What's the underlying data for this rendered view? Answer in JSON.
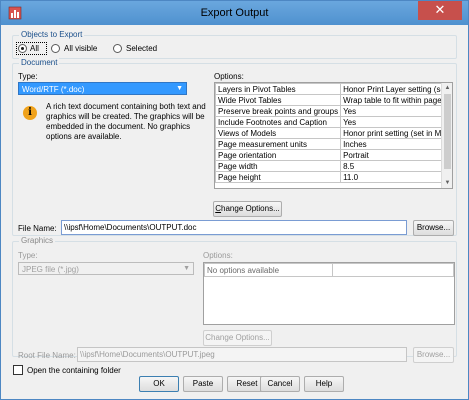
{
  "window": {
    "title": "Export Output",
    "close_glyph": "✕"
  },
  "objects": {
    "legend": "Objects to Export",
    "options": [
      {
        "label": "All",
        "selected": true
      },
      {
        "label": "All visible",
        "selected": false
      },
      {
        "label": "Selected",
        "selected": false
      }
    ]
  },
  "document": {
    "legend": "Document",
    "type_label": "Type:",
    "type_value": "Word/RTF (*.doc)",
    "info_icon": "info-icon",
    "description": "A rich text document containing both text and graphics will be created. The graphics will be embedded in the document. No graphics options are available.",
    "options_label": "Options:",
    "options": [
      [
        "Layers in Pivot Tables",
        "Honor Print Layer setting (set in ..."
      ],
      [
        "Wide Pivot Tables",
        "Wrap table to fit within page mar..."
      ],
      [
        "Preserve break points and groups",
        "Yes"
      ],
      [
        "Include Footnotes and Caption",
        "Yes"
      ],
      [
        "Views of Models",
        "Honor print setting (set in Model ..."
      ],
      [
        "Page measurement units",
        "Inches"
      ],
      [
        "Page orientation",
        "Portrait"
      ],
      [
        "Page width",
        "8.5"
      ],
      [
        "Page height",
        "11.0"
      ]
    ],
    "change_options": "Change Options...",
    "file_name_label": "File Name:",
    "file_name_value": "\\\\ipsf\\Home\\Documents\\OUTPUT.doc",
    "browse": "Browse..."
  },
  "graphics": {
    "legend": "Graphics",
    "type_label": "Type:",
    "type_value": "JPEG file (*.jpg)",
    "options_label": "Options:",
    "options_placeholder": "No options available",
    "change_options": "Change Options...",
    "root_file_label": "Root File Name:",
    "root_file_value": "\\\\ipsf\\Home\\Documents\\OUTPUT.jpeg",
    "browse": "Browse..."
  },
  "open_folder": {
    "label": "Open the containing folder",
    "checked": false
  },
  "buttons": {
    "ok": "OK",
    "paste": "Paste",
    "reset": "Reset",
    "cancel": "Cancel",
    "help": "Help"
  }
}
